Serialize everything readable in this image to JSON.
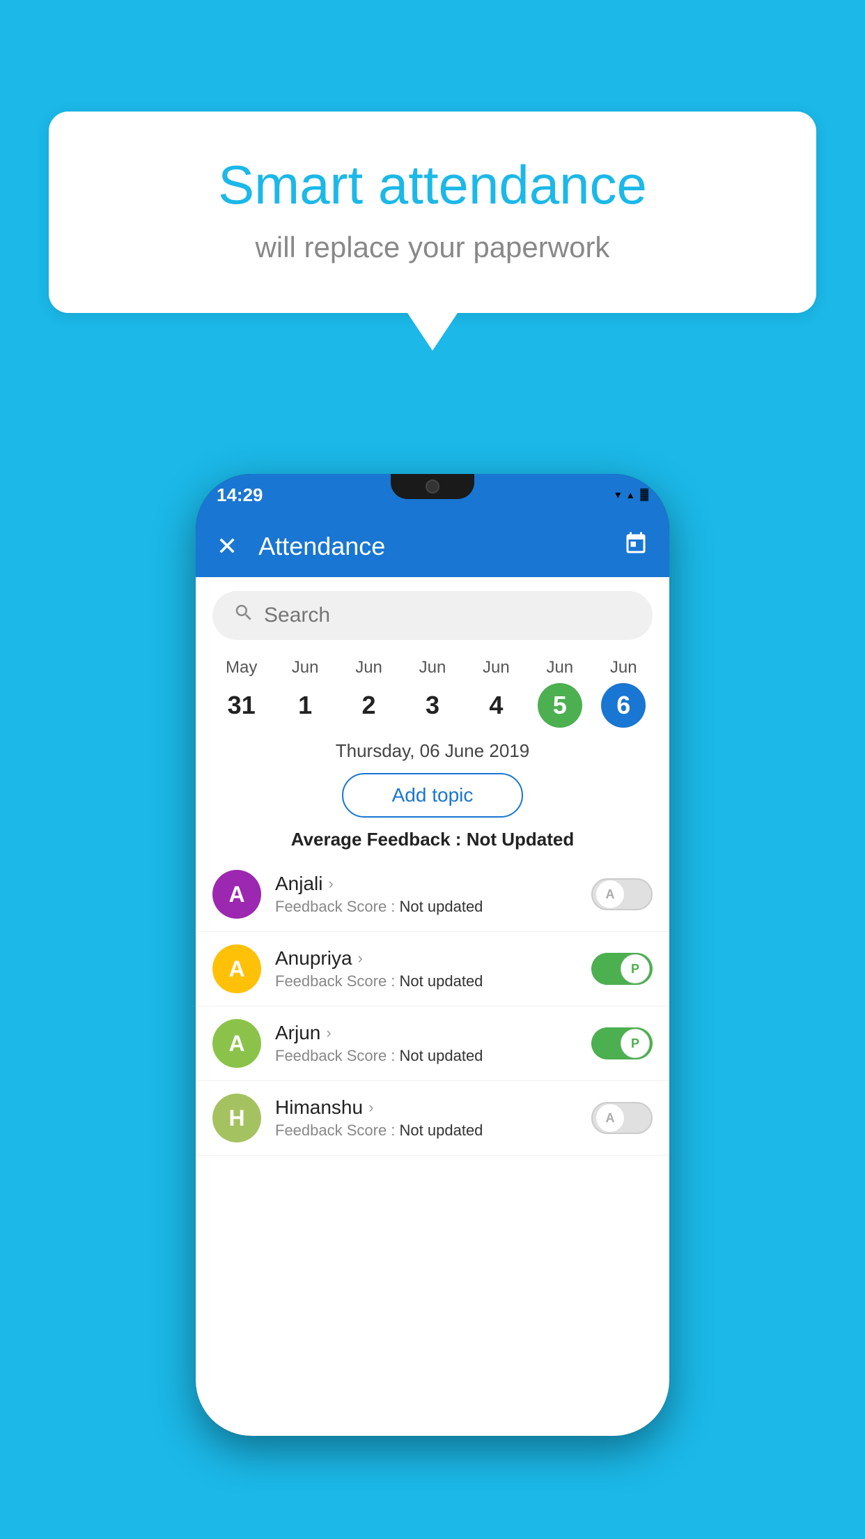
{
  "background_color": "#1bb8e8",
  "speech_bubble": {
    "title": "Smart attendance",
    "subtitle": "will replace your paperwork"
  },
  "status_bar": {
    "time": "14:29",
    "wifi": "▼",
    "signal": "▲",
    "battery": "▓"
  },
  "app_bar": {
    "title": "Attendance",
    "close_label": "✕",
    "calendar_icon": "📅"
  },
  "search": {
    "placeholder": "Search"
  },
  "calendar": {
    "days": [
      {
        "month": "May",
        "date": "31",
        "state": "normal"
      },
      {
        "month": "Jun",
        "date": "1",
        "state": "normal"
      },
      {
        "month": "Jun",
        "date": "2",
        "state": "normal"
      },
      {
        "month": "Jun",
        "date": "3",
        "state": "normal"
      },
      {
        "month": "Jun",
        "date": "4",
        "state": "normal"
      },
      {
        "month": "Jun",
        "date": "5",
        "state": "today"
      },
      {
        "month": "Jun",
        "date": "6",
        "state": "selected"
      }
    ]
  },
  "selected_date": "Thursday, 06 June 2019",
  "add_topic_label": "Add topic",
  "avg_feedback_label": "Average Feedback : ",
  "avg_feedback_value": "Not Updated",
  "students": [
    {
      "name": "Anjali",
      "avatar_letter": "A",
      "avatar_color": "#9c27b0",
      "feedback_label": "Feedback Score : ",
      "feedback_value": "Not updated",
      "attendance": "absent"
    },
    {
      "name": "Anupriya",
      "avatar_letter": "A",
      "avatar_color": "#ffc107",
      "feedback_label": "Feedback Score : ",
      "feedback_value": "Not updated",
      "attendance": "present"
    },
    {
      "name": "Arjun",
      "avatar_letter": "A",
      "avatar_color": "#8bc34a",
      "feedback_label": "Feedback Score : ",
      "feedback_value": "Not updated",
      "attendance": "present"
    },
    {
      "name": "Himanshu",
      "avatar_letter": "H",
      "avatar_color": "#a5c261",
      "feedback_label": "Feedback Score : ",
      "feedback_value": "Not updated",
      "attendance": "absent"
    }
  ]
}
